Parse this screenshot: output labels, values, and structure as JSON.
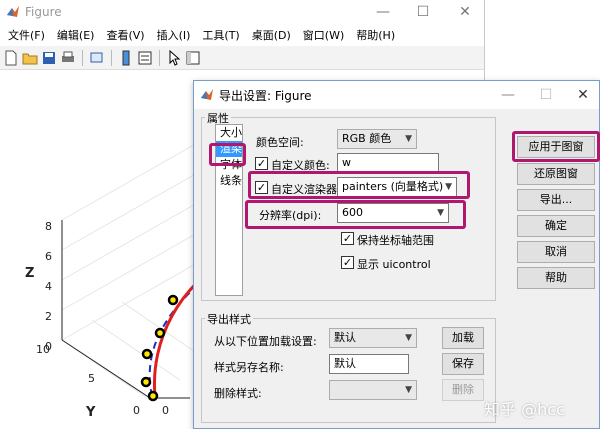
{
  "figure": {
    "title": "Figure",
    "menu": [
      "文件(F)",
      "编辑(E)",
      "查看(V)",
      "插入(I)",
      "工具(T)",
      "桌面(D)",
      "窗口(W)",
      "帮助(H)"
    ],
    "axes": {
      "z_label": "Z",
      "y_label": "Y",
      "z_ticks": [
        "8",
        "6",
        "4",
        "2",
        "0"
      ],
      "y_ticks": [
        "10",
        "5",
        "0"
      ],
      "x_ticks": [
        "0"
      ]
    }
  },
  "dialog": {
    "title": "导出设置: Figure",
    "properties_label": "属性",
    "prop_items": [
      "大小",
      "渲染",
      "字体",
      "线条"
    ],
    "color_space_label": "颜色空间:",
    "color_space_value": "RGB 颜色",
    "custom_color_label": "自定义颜色:",
    "custom_color_value": "w",
    "custom_renderer_label": "自定义渲染器:",
    "custom_renderer_value": "painters (向量格式)",
    "resolution_label": "分辨率(dpi):",
    "resolution_value": "600",
    "keep_axes_label": "保持坐标轴范围",
    "show_uicontrol_label": "显示 uicontrol",
    "buttons": {
      "apply": "应用于图窗",
      "restore": "还原图窗",
      "export": "导出...",
      "ok": "确定",
      "cancel": "取消",
      "help": "帮助"
    },
    "export_styles_label": "导出样式",
    "load_label": "从以下位置加载设置:",
    "load_value": "默认",
    "load_button": "加载",
    "save_label": "样式另存名称:",
    "save_value": "默认",
    "save_button": "保存",
    "delete_label": "删除样式:",
    "delete_value": "",
    "delete_button": "删除"
  },
  "watermark": "知乎 @hcc",
  "colors": {
    "highlight": "#b0176e",
    "curve_red": "#e02020",
    "curve_blue": "#1030c0",
    "marker": "#ffe600"
  }
}
